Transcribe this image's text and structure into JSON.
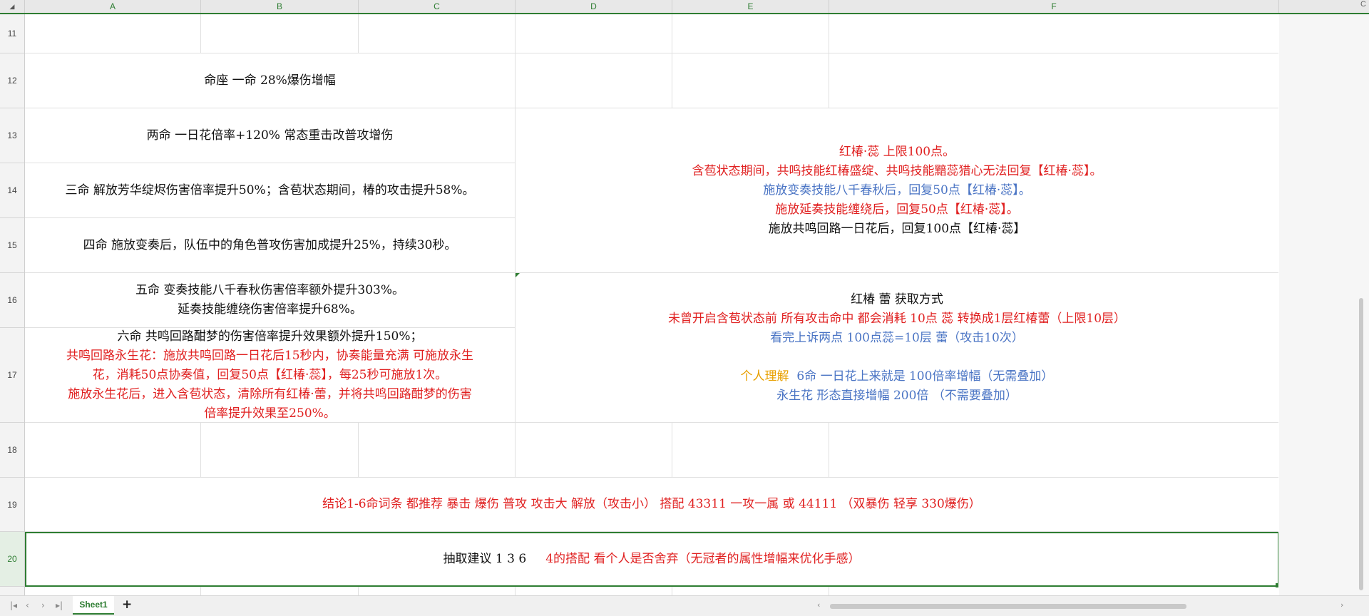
{
  "sheet": {
    "corner_icon": "select-all-triangle-icon",
    "columns": [
      "A",
      "B",
      "C",
      "D",
      "E",
      "F"
    ],
    "rows": [
      "11",
      "12",
      "13",
      "14",
      "15",
      "16",
      "17",
      "18",
      "19",
      "20"
    ],
    "selected_row": "20"
  },
  "cells": {
    "r12": [
      "命座 一命 28%爆伤增幅"
    ],
    "r13": [
      "两命 一日花倍率+120% 常态重击改普攻增伤"
    ],
    "r14": [
      "三命 解放芳华绽烬伤害倍率提升50%；含苞状态期间，椿的攻击提升58%。"
    ],
    "r15": [
      "四命 施放变奏后，队伍中的角色普攻伤害加成提升25%，持续30秒。"
    ],
    "r16": [
      "五命 变奏技能八千春秋伤害倍率额外提升303%。",
      "延奏技能缠绕伤害倍率提升68%。"
    ],
    "r17": [
      "六命 共鸣回路酣梦的伤害倍率提升效果额外提升150%；",
      "共鸣回路永生花：施放共鸣回路一日花后15秒内，协奏能量充满 可施放永生",
      "花，消耗50点协奏值，回复50点【红椿·蕊】，每25秒可施放1次。",
      "施放永生花后，进入含苞状态，清除所有红椿·蕾，并将共鸣回路酣梦的伤害",
      "倍率提升效果至250%。"
    ],
    "merged_13_15": [
      "红椿·蕊 上限100点。",
      "含苞状态期间，共鸣技能红椿盛绽、共鸣技能黯蕊猎心无法回复【红椿·蕊】。",
      "施放变奏技能八千春秋后，回复50点【红椿·蕊】。",
      "施放延奏技能缠绕后，回复50点【红椿·蕊】。",
      "施放共鸣回路一日花后，回复100点【红椿·蕊】"
    ],
    "merged_16_17": {
      "title": "红椿 蕾 获取方式",
      "line2": "未曾开启含苞状态前 所有攻击命中 都会消耗 10点 蕊 转换成1层红椿蕾（上限10层）",
      "line3": "看完上诉两点 100点蕊=10层 蕾（攻击10次）",
      "line4_label": "个人理解",
      "line4_text": "6命 一日花上来就是 100倍率增幅（无需叠加）",
      "line5": "永生花 形态直接增幅 200倍 （不需要叠加）"
    },
    "r19": "结论1-6命词条 都推荐 暴击 爆伤 普攻 攻击大 解放（攻击小） 搭配 43311 一攻一属  或 44111 （双暴伤 轻享 330爆伤）",
    "r20_black": "抽取建议 1 3 6",
    "r20_red": "4的搭配  看个人是否舍弃（无冠者的属性增幅来优化手感）"
  },
  "bottom": {
    "sheet_tab": "Sheet1",
    "add_sheet": "+",
    "nav_icons": [
      "first-sheet-icon",
      "prev-sheet-icon",
      "next-sheet-icon",
      "last-sheet-icon"
    ]
  },
  "colors": {
    "accent": "#2e7d32",
    "red_text": "#e02020",
    "blue_text": "#4a74c4",
    "orange_text": "#e8a000"
  }
}
